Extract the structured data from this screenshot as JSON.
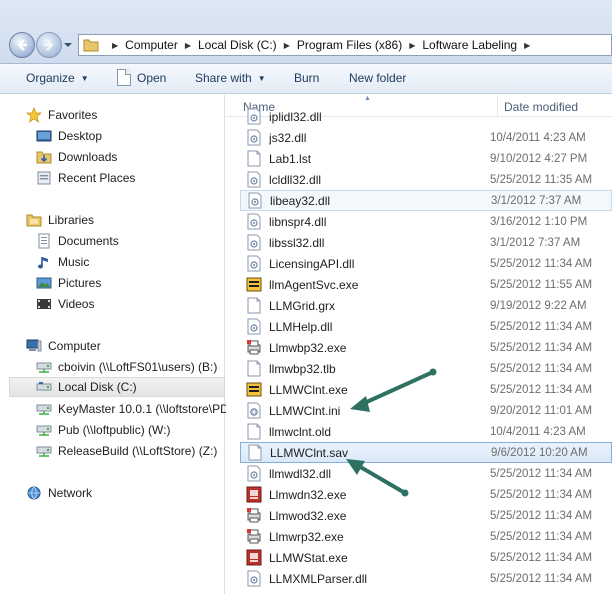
{
  "address": {
    "crumbs": [
      "Computer",
      "Local Disk (C:)",
      "Program Files (x86)",
      "Loftware Labeling"
    ]
  },
  "toolbar": {
    "organize": "Organize",
    "open": "Open",
    "share_with": "Share with",
    "burn": "Burn",
    "new_folder": "New folder"
  },
  "nav": {
    "favorites": "Favorites",
    "desktop": "Desktop",
    "downloads": "Downloads",
    "recent_places": "Recent Places",
    "libraries": "Libraries",
    "documents": "Documents",
    "music": "Music",
    "pictures": "Pictures",
    "videos": "Videos",
    "computer": "Computer",
    "drive1": "cboivin (\\\\LoftFS01\\users) (B:)",
    "drive2": "Local Disk (C:)",
    "drive3": "KeyMaster 10.0.1 (\\\\loftstore\\PD",
    "drive4": "Pub (\\\\loftpublic) (W:)",
    "drive5": "ReleaseBuild (\\\\LoftStore) (Z:)",
    "network": "Network"
  },
  "columns": {
    "name": "Name",
    "date_modified": "Date modified"
  },
  "files": [
    {
      "name": "iplidl32.dll",
      "date": "",
      "icon": "dll-icon"
    },
    {
      "name": "js32.dll",
      "date": "10/4/2011 4:23 AM",
      "icon": "dll-icon"
    },
    {
      "name": "Lab1.lst",
      "date": "9/10/2012 4:27 PM",
      "icon": "file-icon"
    },
    {
      "name": "lcldll32.dll",
      "date": "5/25/2012 11:35 AM",
      "icon": "dll-icon"
    },
    {
      "name": "libeay32.dll",
      "date": "3/1/2012 7:37 AM",
      "icon": "dll-icon"
    },
    {
      "name": "libnspr4.dll",
      "date": "3/16/2012 1:10 PM",
      "icon": "dll-icon"
    },
    {
      "name": "libssl32.dll",
      "date": "3/1/2012 7:37 AM",
      "icon": "dll-icon"
    },
    {
      "name": "LicensingAPI.dll",
      "date": "5/25/2012 11:34 AM",
      "icon": "dll-icon"
    },
    {
      "name": "llmAgentSvc.exe",
      "date": "5/25/2012 11:55 AM",
      "icon": "exe-yellow-icon"
    },
    {
      "name": "LLMGrid.grx",
      "date": "9/19/2012 9:22 AM",
      "icon": "file-icon"
    },
    {
      "name": "LLMHelp.dll",
      "date": "5/25/2012 11:34 AM",
      "icon": "dll-icon"
    },
    {
      "name": "Llmwbp32.exe",
      "date": "5/25/2012 11:34 AM",
      "icon": "exe-print-icon"
    },
    {
      "name": "llmwbp32.tlb",
      "date": "5/25/2012 11:34 AM",
      "icon": "file-icon"
    },
    {
      "name": "LLMWClnt.exe",
      "date": "5/25/2012 11:34 AM",
      "icon": "exe-yellow-icon"
    },
    {
      "name": "LLMWClnt.ini",
      "date": "9/20/2012 11:01 AM",
      "icon": "ini-icon"
    },
    {
      "name": "llmwclnt.old",
      "date": "10/4/2011 4:23 AM",
      "icon": "file-icon"
    },
    {
      "name": "LLMWClnt.sav",
      "date": "9/6/2012 10:20 AM",
      "icon": "file-icon"
    },
    {
      "name": "llmwdl32.dll",
      "date": "5/25/2012 11:34 AM",
      "icon": "dll-icon"
    },
    {
      "name": "Llmwdn32.exe",
      "date": "5/25/2012 11:34 AM",
      "icon": "exe-red-icon"
    },
    {
      "name": "Llmwod32.exe",
      "date": "5/25/2012 11:34 AM",
      "icon": "exe-print-icon"
    },
    {
      "name": "Llmwrp32.exe",
      "date": "5/25/2012 11:34 AM",
      "icon": "exe-print-icon"
    },
    {
      "name": "LLMWStat.exe",
      "date": "5/25/2012 11:34 AM",
      "icon": "exe-red-icon"
    },
    {
      "name": "LLMXMLParser.dll",
      "date": "5/25/2012 11:34 AM",
      "icon": "dll-icon"
    }
  ],
  "colors": {
    "arrow": "#2e7062",
    "selection": "#84acdd"
  }
}
